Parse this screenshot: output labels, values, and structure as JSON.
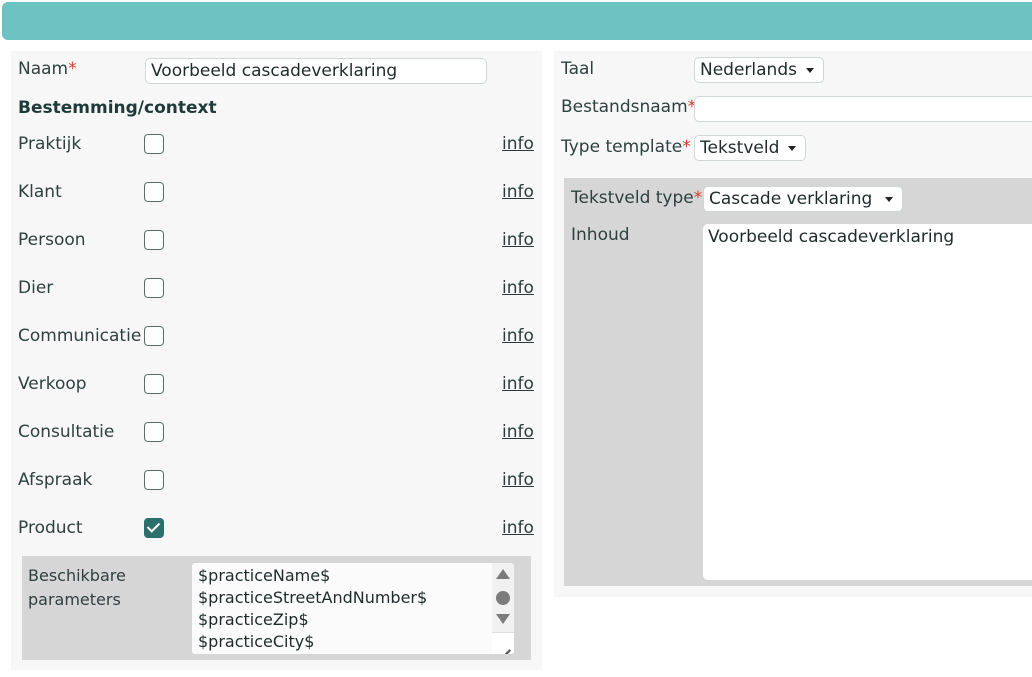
{
  "form": {
    "naam_label": "Naam",
    "naam_value": "Voorbeeld cascadeverklaring",
    "required_mark": "*",
    "section_title": "Bestemming/context",
    "contexts": [
      {
        "label": "Praktijk",
        "checked": false,
        "info": "info"
      },
      {
        "label": "Klant",
        "checked": false,
        "info": "info"
      },
      {
        "label": "Persoon",
        "checked": false,
        "info": "info"
      },
      {
        "label": "Dier",
        "checked": false,
        "info": "info"
      },
      {
        "label": "Communicatie",
        "checked": false,
        "info": "info"
      },
      {
        "label": "Verkoop",
        "checked": false,
        "info": "info"
      },
      {
        "label": "Consultatie",
        "checked": false,
        "info": "info"
      },
      {
        "label": "Afspraak",
        "checked": false,
        "info": "info"
      },
      {
        "label": "Product",
        "checked": true,
        "info": "info"
      }
    ],
    "params_label_1": "Beschikbare",
    "params_label_2": "parameters",
    "parameters": [
      "$practiceName$",
      "$practiceStreetAndNumber$",
      "$practiceZip$",
      "$practiceCity$"
    ]
  },
  "right": {
    "taal_label": "Taal",
    "taal_value": "Nederlands",
    "bestandsnaam_label": "Bestandsnaam",
    "bestandsnaam_value": "",
    "type_template_label": "Type template",
    "type_template_value": "Tekstveld",
    "tekstveld_type_label": "Tekstveld type",
    "tekstveld_type_value": "Cascade verklaring",
    "inhoud_label": "Inhoud",
    "inhoud_value": "Voorbeeld cascadeverklaring"
  },
  "colors": {
    "topbar": "#6cc3c1",
    "checkbox_checked": "#2c706e",
    "required": "#d23b2b"
  }
}
